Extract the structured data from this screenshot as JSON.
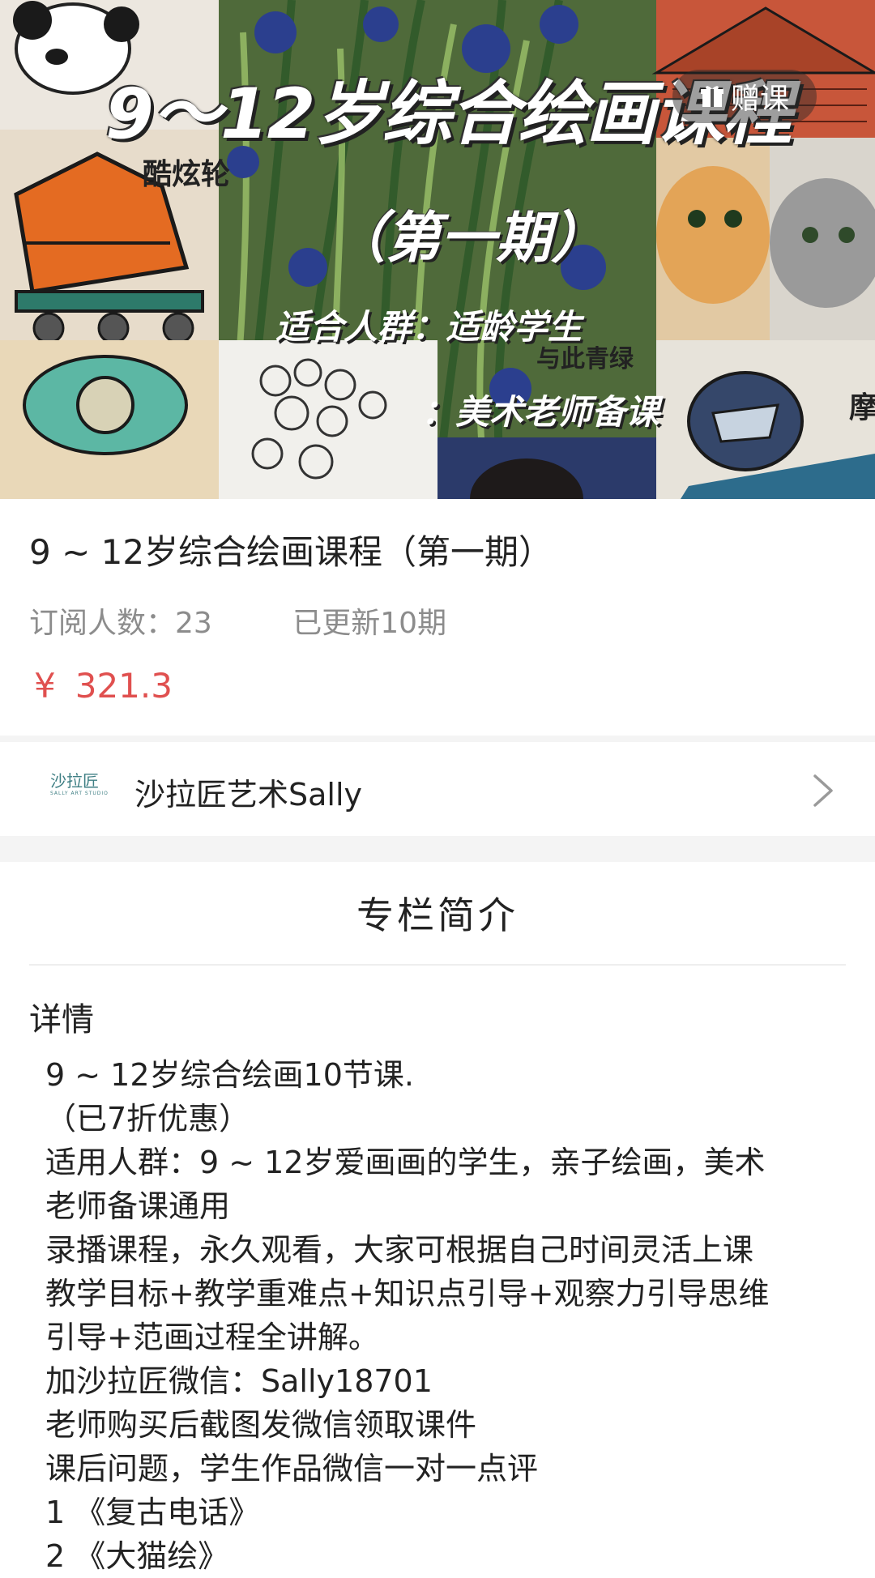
{
  "banner": {
    "title": "9～12岁综合绘画课程",
    "subtitle": "（第一期）",
    "audience": "适合人群：适龄学生",
    "teachers": "：美术老师备课",
    "caption_skate": "酷炫轮",
    "caption_cat": "与此青绿",
    "caption_moto": "摩",
    "gift_label": "赠课"
  },
  "course": {
    "title": "9 ~ 12岁综合绘画课程（第一期）",
    "subscribers": "订阅人数：23",
    "updates": "已更新10期",
    "currency": "¥",
    "price": "321.3"
  },
  "author": {
    "logo_text": "沙拉匠",
    "logo_sub": "SALLY ART STUDIO",
    "name": "沙拉匠艺术Sally"
  },
  "intro": {
    "section_title": "专栏简介",
    "details_label": "详情",
    "lines": [
      "9 ~ 12岁综合绘画10节课.",
      "（已7折优惠）",
      "适用人群：9 ~ 12岁爱画画的学生，亲子绘画，美术",
      "老师备课通用",
      "录播课程，永久观看，大家可根据自己时间灵活上课",
      "教学目标+教学重难点+知识点引导+观察力引导思维",
      "引导+范画过程全讲解。",
      "加沙拉匠微信：Sally18701",
      "老师购买后截图发微信领取课件",
      "课后问题，学生作品微信一对一点评",
      "1 《复古电话》",
      "2 《大猫绘》"
    ]
  },
  "colors": {
    "price": "#e0504f",
    "muted": "#8c8c8c",
    "text": "#222222",
    "brand_logo": "#3f7f84"
  }
}
